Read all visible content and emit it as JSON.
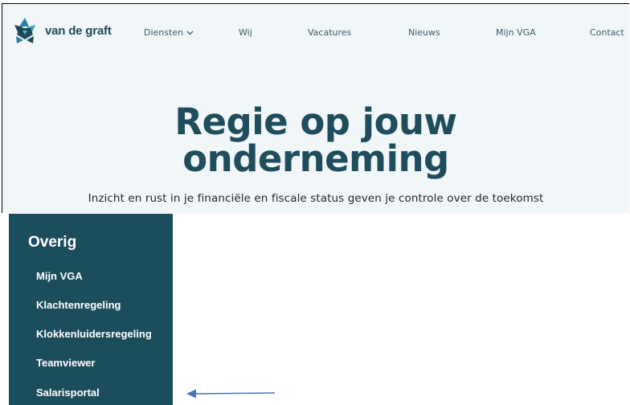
{
  "header": {
    "logo_text": "van de graft",
    "nav": [
      {
        "label": "Diensten"
      },
      {
        "label": "Wij"
      },
      {
        "label": "Vacatures"
      },
      {
        "label": "Nieuws"
      },
      {
        "label": "Mijn VGA"
      },
      {
        "label": "Contact"
      }
    ]
  },
  "hero": {
    "title_line1": "Regie op jouw",
    "title_line2": "onderneming",
    "subtitle": "Inzicht en rust in je financiële en fiscale status geven je controle over de toekomst"
  },
  "sidebar": {
    "heading": "Overig",
    "items": [
      {
        "label": "Mijn VGA"
      },
      {
        "label": "Klachtenregeling"
      },
      {
        "label": "Klokkenluidersregeling"
      },
      {
        "label": "Teamviewer"
      },
      {
        "label": "Salarisportal"
      }
    ]
  },
  "colors": {
    "brand_dark": "#1c4d5d",
    "hero_bg": "#f1f6f9",
    "arrow": "#4a74b8"
  }
}
